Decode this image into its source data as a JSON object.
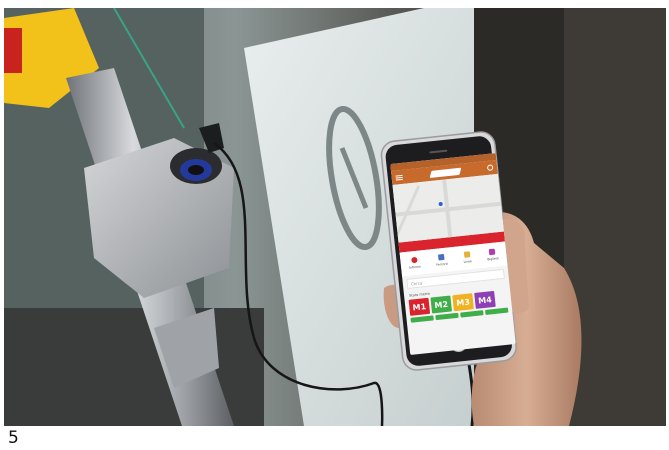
{
  "caption": {
    "number": "5"
  },
  "phone": {
    "app": {
      "actions": [
        {
          "label": "Informo",
          "color": "#d9232d"
        },
        {
          "label": "Percorsi",
          "color": "#4a6fc2"
        },
        {
          "label": "Linee",
          "color": "#e2b23c"
        },
        {
          "label": "Biglietti",
          "color": "#b43ab2"
        }
      ],
      "search_placeholder": "Cerca",
      "lines_label": "Stato metro",
      "metro_lines": [
        {
          "label": "M1",
          "color": "#d9232d"
        },
        {
          "label": "M2",
          "color": "#3fae49"
        },
        {
          "label": "M3",
          "color": "#f1b221"
        },
        {
          "label": "M4",
          "color": "#8f3fb3"
        }
      ],
      "colors": {
        "header": "#c76a2c",
        "status_bar": "#b4612a",
        "alert_bar": "#d9232d"
      }
    }
  },
  "icons": [
    "menu-icon",
    "gear-icon",
    "map-pin-icon",
    "usb-charger-icon"
  ],
  "colors": {
    "handrail_yellow": "#f2c21a",
    "background": "#6e7a78"
  }
}
